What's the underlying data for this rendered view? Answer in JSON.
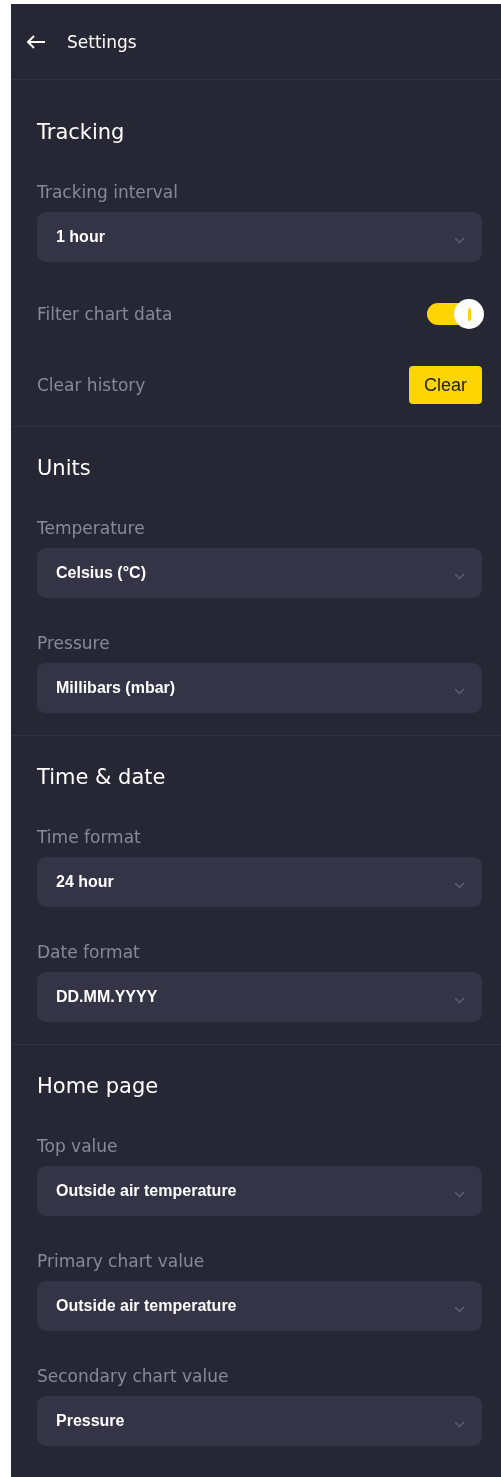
{
  "header": {
    "title": "Settings"
  },
  "sections": [
    {
      "title": "Tracking",
      "items": [
        {
          "kind": "select",
          "label": "Tracking interval",
          "value": "1 hour"
        },
        {
          "kind": "toggle",
          "label": "Filter chart data",
          "on": true
        },
        {
          "kind": "button",
          "label": "Clear history",
          "button": "Clear"
        }
      ]
    },
    {
      "title": "Units",
      "items": [
        {
          "kind": "select",
          "label": "Temperature",
          "value": "Celsius (°C)"
        },
        {
          "kind": "select",
          "label": "Pressure",
          "value": "Millibars (mbar)"
        }
      ]
    },
    {
      "title": "Time & date",
      "items": [
        {
          "kind": "select",
          "label": "Time format",
          "value": "24 hour"
        },
        {
          "kind": "select",
          "label": "Date format",
          "value": "DD.MM.YYYY"
        }
      ]
    },
    {
      "title": "Home page",
      "items": [
        {
          "kind": "select",
          "label": "Top value",
          "value": "Outside air temperature"
        },
        {
          "kind": "select",
          "label": "Primary chart value",
          "value": "Outside air temperature"
        },
        {
          "kind": "select",
          "label": "Secondary chart value",
          "value": "Pressure"
        }
      ]
    }
  ]
}
